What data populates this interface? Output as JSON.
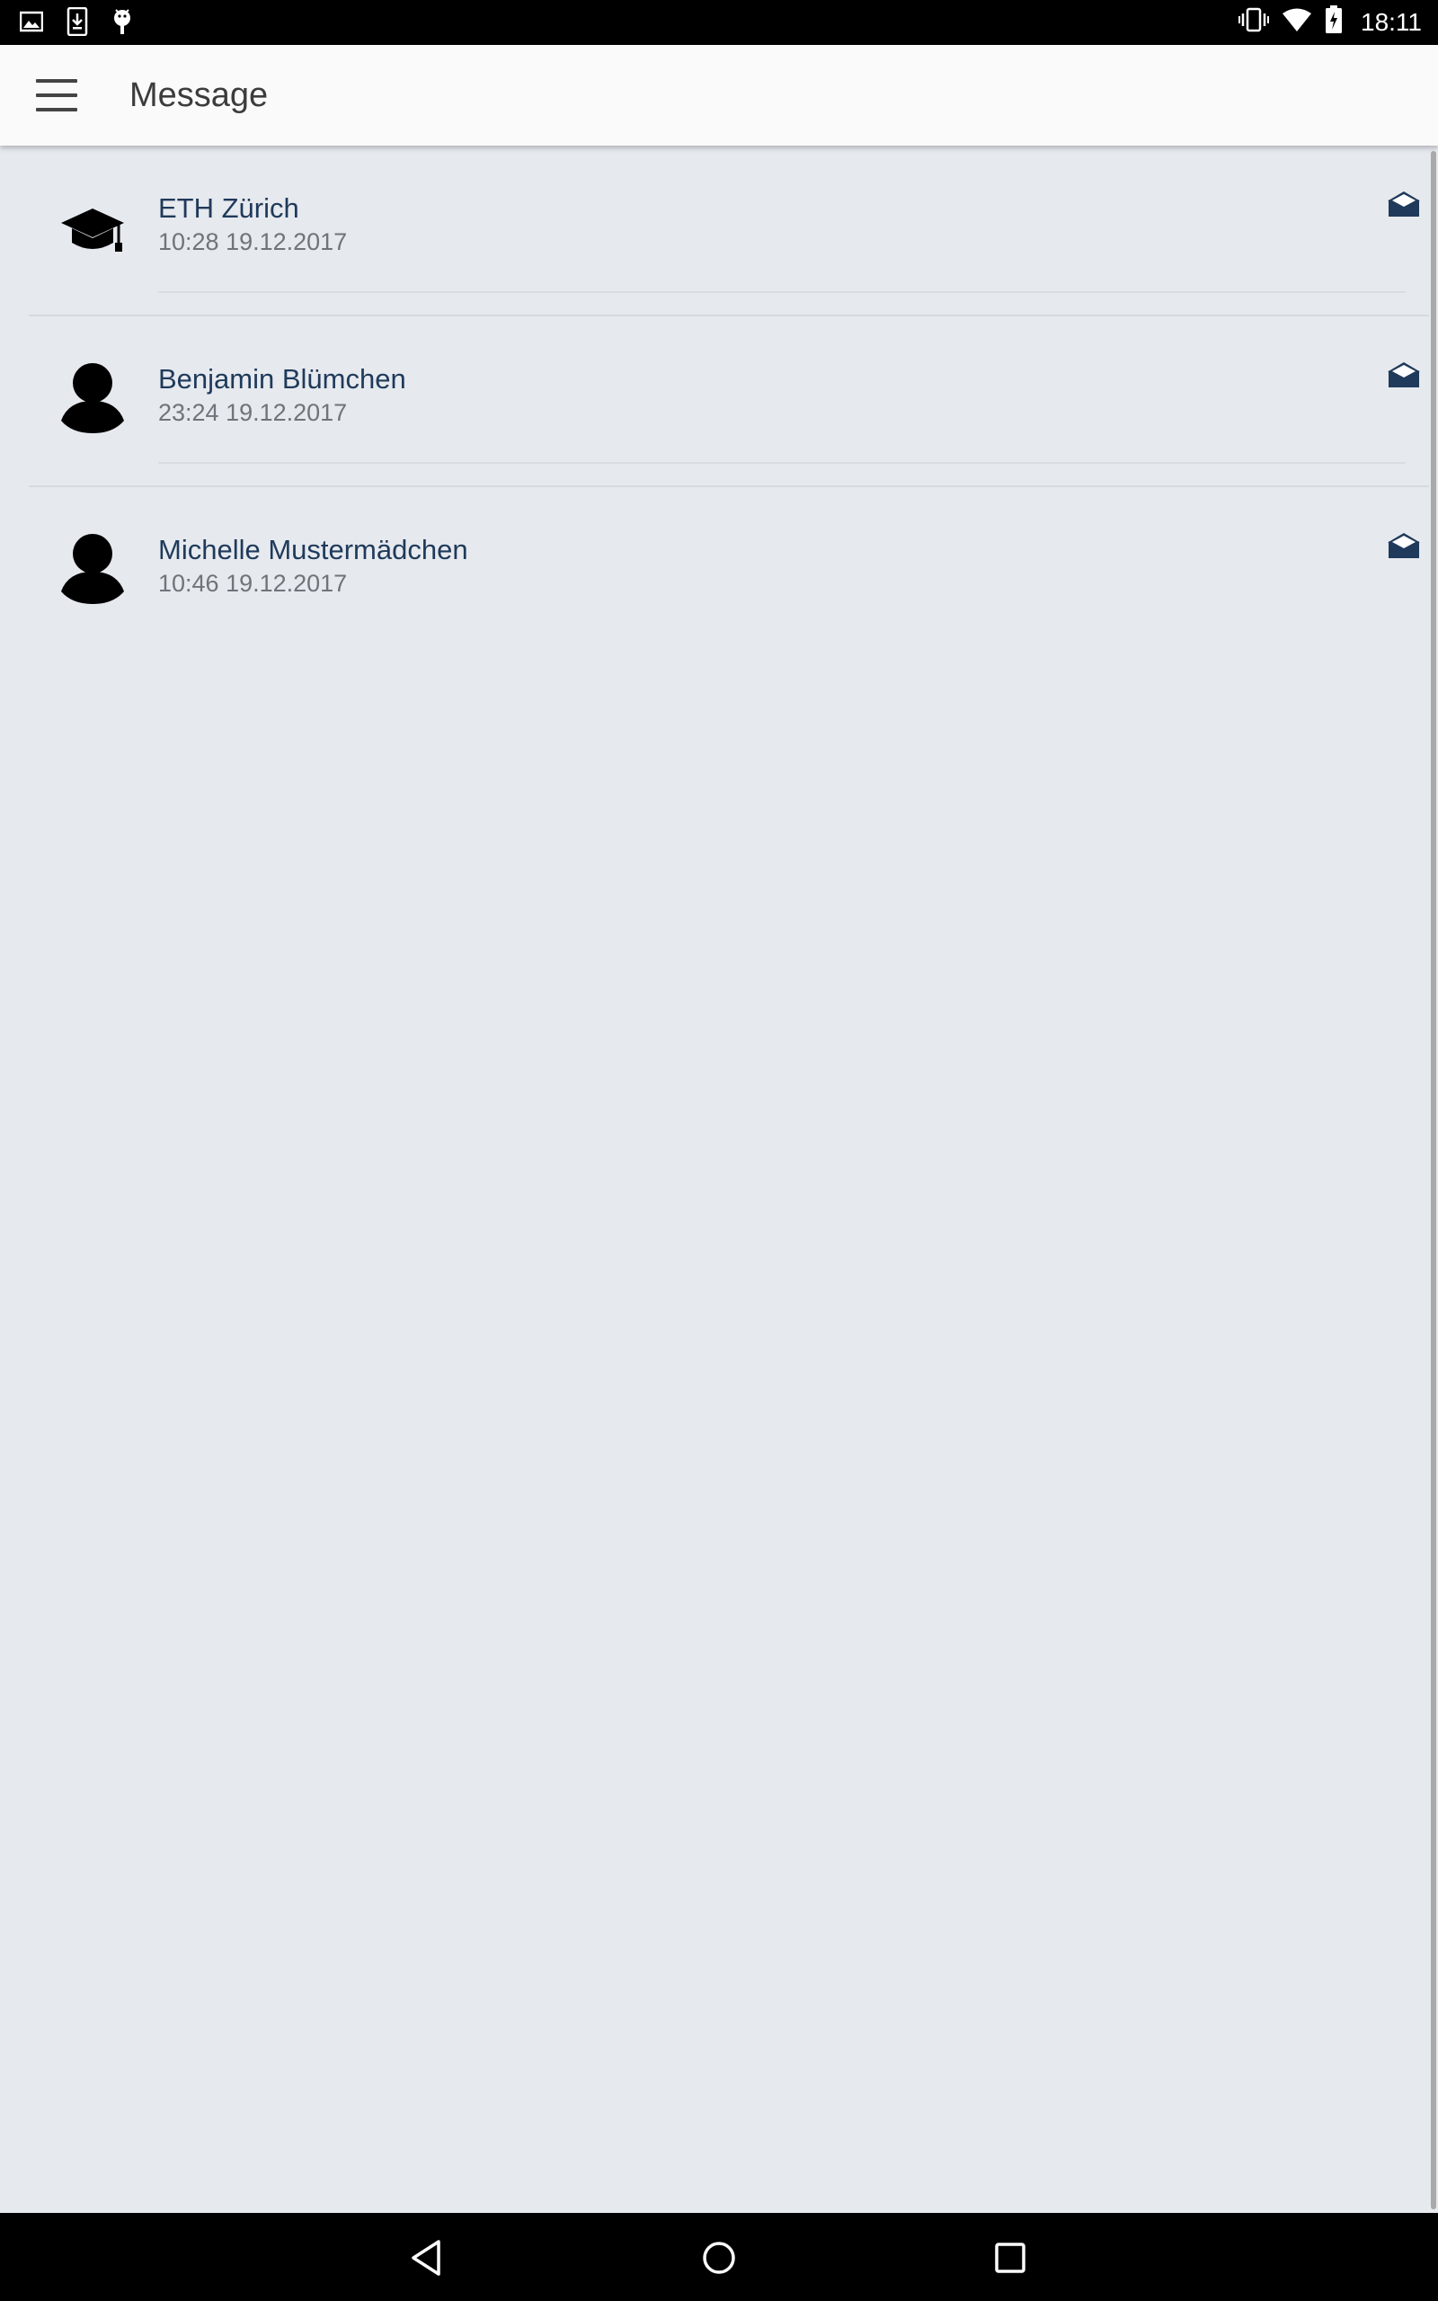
{
  "status_bar": {
    "time": "18:11",
    "left_icons": [
      "image-icon",
      "download-icon",
      "android-icon"
    ],
    "right_icons": [
      "vibrate-icon",
      "wifi-icon",
      "battery-charging-icon"
    ]
  },
  "app_bar": {
    "title": "Message",
    "menu_icon": "hamburger-menu-icon"
  },
  "messages": [
    {
      "sender": "ETH Zürich",
      "time": "10:28 19.12.2017",
      "avatar": "graduation-cap-icon",
      "status_icon": "open-envelope-icon"
    },
    {
      "sender": "Benjamin Blümchen",
      "time": "23:24 19.12.2017",
      "avatar": "person-icon",
      "status_icon": "open-envelope-icon"
    },
    {
      "sender": "Michelle Mustermädchen",
      "time": "10:46 19.12.2017",
      "avatar": "person-icon",
      "status_icon": "open-envelope-icon"
    }
  ],
  "nav_bar": {
    "back": "back-triangle-icon",
    "home": "home-circle-icon",
    "recents": "recents-square-icon"
  },
  "colors": {
    "background": "#e6e9ee",
    "app_bar": "#fafafa",
    "sender_name": "#1f3a5a",
    "mail_icon": "#1f3a5a",
    "time_text": "#6f747a"
  }
}
